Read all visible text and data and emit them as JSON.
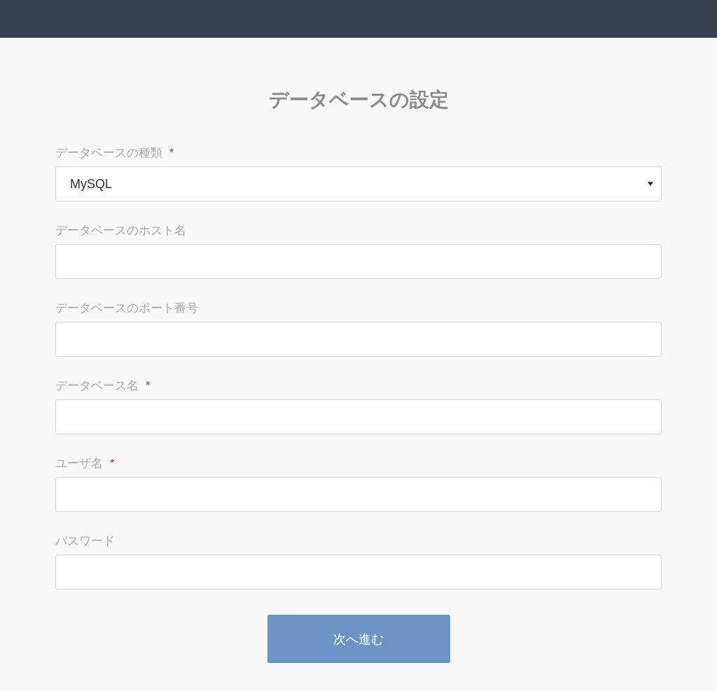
{
  "title": "データベースの設定",
  "fields": [
    {
      "kind": "select",
      "label": "データベースの種類",
      "required_mark": "*",
      "value": "MySQL"
    },
    {
      "kind": "text",
      "label": "データベースのホスト名"
    },
    {
      "kind": "text",
      "label": "データベースのポート番号"
    },
    {
      "kind": "text",
      "label": "データベース名",
      "required_mark": "*"
    },
    {
      "kind": "text",
      "label": "ユーザ名",
      "required_mark": "*"
    },
    {
      "kind": "password",
      "label": "パスワード"
    }
  ],
  "submit": "次へ進む"
}
